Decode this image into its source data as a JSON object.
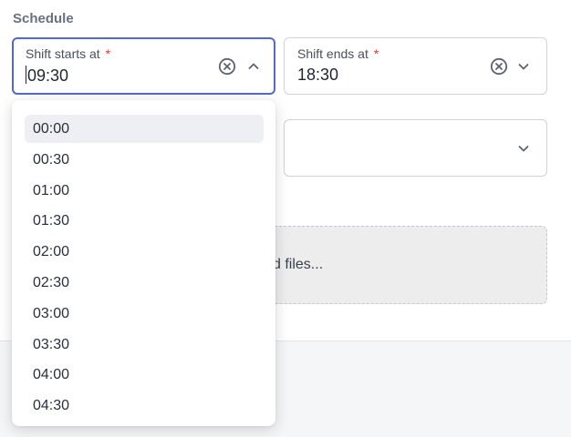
{
  "section": {
    "title": "Schedule"
  },
  "shift_start": {
    "label": "Shift starts at",
    "required_mark": "*",
    "value": "09:30",
    "clear_icon": "clear-icon",
    "toggle_icon": "chevron-up-icon"
  },
  "shift_end": {
    "label": "Shift ends at",
    "required_mark": "*",
    "value": "18:30",
    "clear_icon": "clear-icon",
    "toggle_icon": "chevron-down-icon"
  },
  "third_field": {
    "toggle_icon": "chevron-down-icon"
  },
  "upload": {
    "text": "d files..."
  },
  "dropdown": {
    "options": [
      "00:00",
      "00:30",
      "01:00",
      "01:30",
      "02:00",
      "02:30",
      "03:00",
      "03:30",
      "04:00",
      "04:30"
    ],
    "highlighted_index": 0
  },
  "colors": {
    "focus_border": "#5468d4",
    "required": "#e53935",
    "highlight": "#eeeff2"
  }
}
